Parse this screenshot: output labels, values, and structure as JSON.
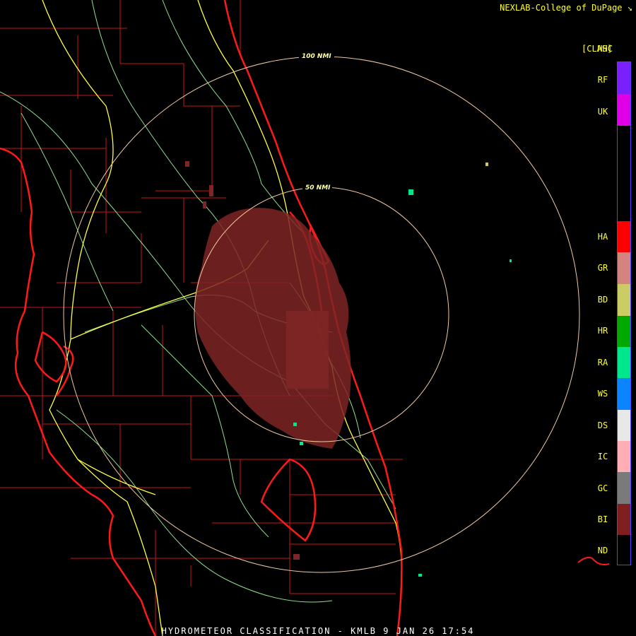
{
  "credit": "NEXLAB-College of DuPage",
  "legend": {
    "title": "HHC",
    "subtitle": "[CLAS]",
    "categories": [
      {
        "code": "RF",
        "color": "#7a20ff"
      },
      {
        "code": "UK",
        "color": "#e000e6"
      },
      {
        "code": "HA",
        "color": "#ff0000"
      },
      {
        "code": "GR",
        "color": "#d4847e"
      },
      {
        "code": "BD",
        "color": "#cccc66"
      },
      {
        "code": "HR",
        "color": "#00a800"
      },
      {
        "code": "RA",
        "color": "#00e68a"
      },
      {
        "code": "WS",
        "color": "#0a84ff"
      },
      {
        "code": "DS",
        "color": "#e8e8e8"
      },
      {
        "code": "IC",
        "color": "#ffaeb4"
      },
      {
        "code": "GC",
        "color": "#7a7a7a"
      },
      {
        "code": "BI",
        "color": "#7f2020"
      },
      {
        "code": "ND",
        "color": "#000000"
      }
    ]
  },
  "rings": [
    {
      "label": "100 NMI"
    },
    {
      "label": "50 NMI"
    }
  ],
  "bottom_title": "HYDROMETEOR CLASSIFICATION - KMLB 9 JAN 26 17:54",
  "colors": {
    "coast": "#ff1a1a",
    "county": "#d01818",
    "highway": "#ffff44",
    "road": "#9de89d",
    "ring": "#f0c8a0",
    "echo": "#7f2525"
  }
}
